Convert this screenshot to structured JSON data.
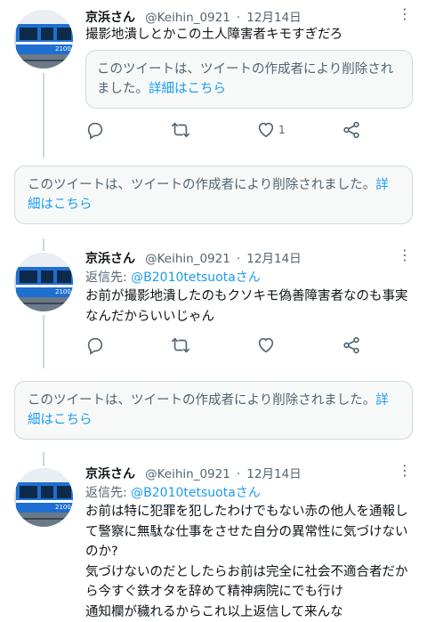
{
  "tweets": [
    {
      "name": "京浜さん",
      "handle": "@Keihin_0921",
      "dot": "·",
      "date": "12月14日",
      "more": "⋮",
      "text": "撮影地潰しとかこの土人障害者キモすぎだろ",
      "quote": {
        "text": "このツイートは、ツイートの作成者により削除されました。",
        "link": "詳細はこちら"
      },
      "likes": "1"
    },
    {
      "name": "京浜さん",
      "handle": "@Keihin_0921",
      "dot": "·",
      "date": "12月14日",
      "more": "⋮",
      "reply_prefix": "返信先: ",
      "reply_mention": "@B2010tetsuotaさん",
      "text": "お前が撮影地潰したのもクソキモ偽善障害者なのも事実なんだからいいじゃん"
    },
    {
      "name": "京浜さん",
      "handle": "@Keihin_0921",
      "dot": "·",
      "date": "12月14日",
      "more": "⋮",
      "reply_prefix": "返信先: ",
      "reply_mention": "@B2010tetsuotaさん",
      "text": "お前は特に犯罪を犯したわけでもない赤の他人を通報して警察に無駄な仕事をさせた自分の異常性に気づけないのか?\n気づけないのだとしたらお前は完全に社会不適合者だから今すぐ鉄オタを辞めて精神病院にでも行け\n通知欄が穢れるからこれ以上返信して来んな"
    }
  ],
  "deleted_notices": [
    {
      "text": "このツイートは、ツイートの作成者により削除されました。",
      "link": "詳細はこちら"
    },
    {
      "text": "このツイートは、ツイートの作成者により削除されました。",
      "link": "詳細はこちら"
    }
  ],
  "avatar_text": "2100",
  "colors": {
    "link": "#1d9bf0",
    "secondary": "#536471",
    "border": "#cfd9de",
    "train_blue": "#1e6fd0"
  },
  "icons": [
    "reply-icon",
    "retweet-icon",
    "like-icon",
    "share-icon",
    "more-icon"
  ]
}
